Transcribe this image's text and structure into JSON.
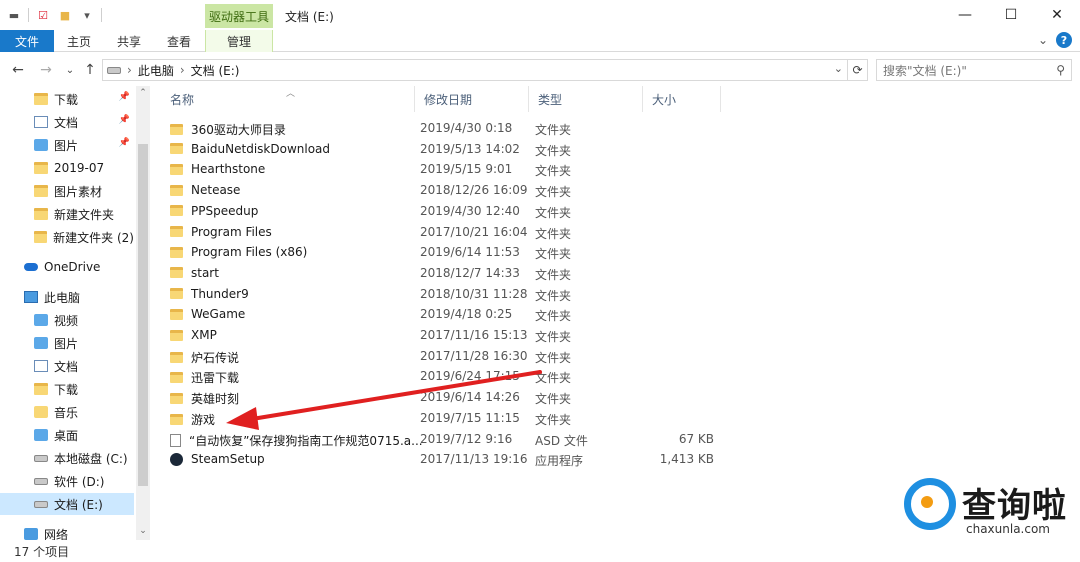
{
  "window": {
    "context_tab_header": "驱动器工具",
    "title": "文档 (E:)",
    "minimize": "—",
    "maximize": "☐",
    "close": "✕"
  },
  "ribbon": {
    "tabs": [
      "文件",
      "主页",
      "共享",
      "查看",
      "管理"
    ],
    "expand": "⌄",
    "help": "?"
  },
  "nav": {
    "back": "←",
    "forward": "→",
    "recent": "⌄",
    "up": "↑",
    "breadcrumb": [
      "此电脑",
      "文档 (E:)"
    ],
    "refresh": "⟳",
    "search_placeholder": "搜索\"文档 (E:)\""
  },
  "navpane": {
    "items": [
      {
        "label": "下载",
        "icon": "download-folder-icon",
        "pinned": true
      },
      {
        "label": "文档",
        "icon": "documents-icon",
        "pinned": true
      },
      {
        "label": "图片",
        "icon": "pictures-icon",
        "pinned": true
      },
      {
        "label": "2019-07",
        "icon": "folder-icon",
        "pinned": false
      },
      {
        "label": "图片素材",
        "icon": "folder-icon",
        "pinned": false
      },
      {
        "label": "新建文件夹",
        "icon": "folder-icon",
        "pinned": false
      },
      {
        "label": "新建文件夹 (2)",
        "icon": "folder-icon",
        "pinned": false
      },
      {
        "label": "OneDrive",
        "icon": "onedrive-icon",
        "pinned": false
      },
      {
        "label": "此电脑",
        "icon": "this-pc-icon",
        "pinned": false
      },
      {
        "label": "视频",
        "icon": "videos-icon",
        "pinned": false
      },
      {
        "label": "图片",
        "icon": "pictures-icon",
        "pinned": false
      },
      {
        "label": "文档",
        "icon": "documents-icon",
        "pinned": false
      },
      {
        "label": "下载",
        "icon": "downloads-icon",
        "pinned": false
      },
      {
        "label": "音乐",
        "icon": "music-icon",
        "pinned": false
      },
      {
        "label": "桌面",
        "icon": "desktop-icon",
        "pinned": false
      },
      {
        "label": "本地磁盘 (C:)",
        "icon": "drive-icon",
        "pinned": false
      },
      {
        "label": "软件 (D:)",
        "icon": "drive-icon",
        "pinned": false
      },
      {
        "label": "文档 (E:)",
        "icon": "drive-icon",
        "pinned": false,
        "selected": true
      },
      {
        "label": "网络",
        "icon": "network-icon",
        "pinned": false
      }
    ]
  },
  "columns": {
    "name": "名称",
    "date": "修改日期",
    "type": "类型",
    "size": "大小"
  },
  "files": [
    {
      "name": "360驱动大师目录",
      "date": "2019/4/30 0:18",
      "type": "文件夹",
      "size": "",
      "kind": "folder"
    },
    {
      "name": "BaiduNetdiskDownload",
      "date": "2019/5/13 14:02",
      "type": "文件夹",
      "size": "",
      "kind": "folder"
    },
    {
      "name": "Hearthstone",
      "date": "2019/5/15 9:01",
      "type": "文件夹",
      "size": "",
      "kind": "folder"
    },
    {
      "name": "Netease",
      "date": "2018/12/26 16:09",
      "type": "文件夹",
      "size": "",
      "kind": "folder"
    },
    {
      "name": "PPSpeedup",
      "date": "2019/4/30 12:40",
      "type": "文件夹",
      "size": "",
      "kind": "folder"
    },
    {
      "name": "Program Files",
      "date": "2017/10/21 16:04",
      "type": "文件夹",
      "size": "",
      "kind": "folder"
    },
    {
      "name": "Program Files (x86)",
      "date": "2019/6/14 11:53",
      "type": "文件夹",
      "size": "",
      "kind": "folder"
    },
    {
      "name": "start",
      "date": "2018/12/7 14:33",
      "type": "文件夹",
      "size": "",
      "kind": "folder"
    },
    {
      "name": "Thunder9",
      "date": "2018/10/31 11:28",
      "type": "文件夹",
      "size": "",
      "kind": "folder"
    },
    {
      "name": "WeGame",
      "date": "2019/4/18 0:25",
      "type": "文件夹",
      "size": "",
      "kind": "folder"
    },
    {
      "name": "XMP",
      "date": "2017/11/16 15:13",
      "type": "文件夹",
      "size": "",
      "kind": "folder"
    },
    {
      "name": "炉石传说",
      "date": "2017/11/28 16:30",
      "type": "文件夹",
      "size": "",
      "kind": "folder"
    },
    {
      "name": "迅雷下载",
      "date": "2019/6/24 17:15",
      "type": "文件夹",
      "size": "",
      "kind": "folder"
    },
    {
      "name": "英雄时刻",
      "date": "2019/6/14 14:26",
      "type": "文件夹",
      "size": "",
      "kind": "folder"
    },
    {
      "name": "游戏",
      "date": "2019/7/15 11:15",
      "type": "文件夹",
      "size": "",
      "kind": "folder"
    },
    {
      "name": "“自动恢复”保存搜狗指南工作规范0715.a...",
      "date": "2019/7/12 9:16",
      "type": "ASD 文件",
      "size": "67 KB",
      "kind": "file"
    },
    {
      "name": "SteamSetup",
      "date": "2017/11/13 19:16",
      "type": "应用程序",
      "size": "1,413 KB",
      "kind": "app"
    }
  ],
  "status": {
    "item_count": "17 个项目"
  },
  "annotation": {
    "arrow_color": "#e02020"
  },
  "watermark": {
    "brand": "查询啦",
    "url": "chaxunla.com",
    "primary_color": "#1e8fe1",
    "accent_color": "#f39c12"
  }
}
